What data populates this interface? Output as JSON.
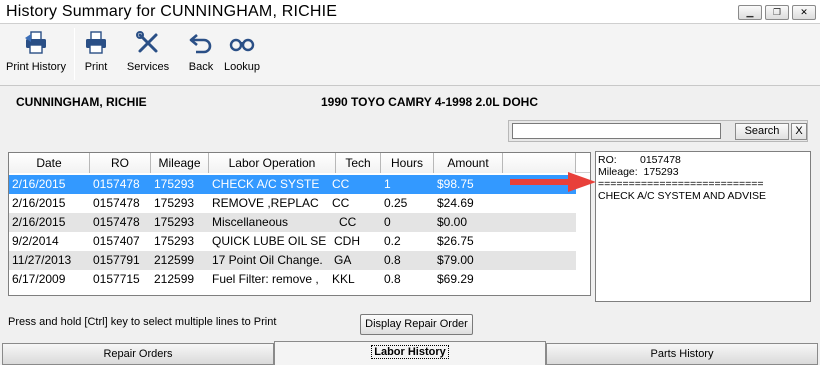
{
  "window": {
    "title": "History Summary for CUNNINGHAM, RICHIE",
    "minimize_glyph": "▁",
    "restore_glyph": "❐",
    "close_glyph": "✕"
  },
  "toolbar": {
    "print_history": "Print History",
    "print": "Print",
    "services": "Services",
    "back": "Back",
    "lookup": "Lookup"
  },
  "customer": {
    "name": "CUNNINGHAM, RICHIE",
    "vehicle": "1990 TOYO CAMRY  4-1998 2.0L DOHC"
  },
  "search": {
    "value": "",
    "button_label": "Search",
    "clear_label": "X"
  },
  "grid": {
    "columns": [
      "Date",
      "RO",
      "Mileage",
      "Labor Operation",
      "Tech",
      "Hours",
      "Amount"
    ],
    "rows": [
      {
        "date": "2/16/2015",
        "ro": "0157478",
        "mileage": "175293",
        "labor": "CHECK A/C SYSTE",
        "tech": "CC",
        "hours": "1",
        "amount": "$98.75"
      },
      {
        "date": "2/16/2015",
        "ro": "0157478",
        "mileage": "175293",
        "labor": "REMOVE ,REPLAC",
        "tech": "CC",
        "hours": "0.25",
        "amount": "$24.69"
      },
      {
        "date": "2/16/2015",
        "ro": "0157478",
        "mileage": "175293",
        "labor": "Miscellaneous",
        "tech": "CC",
        "hours": "0",
        "amount": "$0.00"
      },
      {
        "date": "9/2/2014",
        "ro": "0157407",
        "mileage": "175293",
        "labor": "QUICK LUBE OIL SE",
        "tech": "CDH",
        "hours": "0.2",
        "amount": "$26.75"
      },
      {
        "date": "11/27/2013",
        "ro": "0157791",
        "mileage": "212599",
        "labor": "17 Point Oil Change.",
        "tech": "GA",
        "hours": "0.8",
        "amount": "$79.00"
      },
      {
        "date": "6/17/2009",
        "ro": "0157715",
        "mileage": "212599",
        "labor": "Fuel Filter: remove ,",
        "tech": "KKL",
        "hours": "0.8",
        "amount": "$69.29"
      }
    ]
  },
  "detail": {
    "ro_line": "RO:        0157478",
    "mileage_line": "Mileage:  175293",
    "separator": "===========================",
    "description": "CHECK A/C SYSTEM AND ADVISE"
  },
  "footer": {
    "hint": "Press and hold [Ctrl] key to select multiple lines to Print",
    "display_repair_order": "Display Repair Order"
  },
  "tabs": {
    "repair_orders": "Repair Orders",
    "labor_history": "Labor History",
    "parts_history": "Parts History"
  },
  "colors": {
    "selection": "#3399ff",
    "alt_row": "#e4e4e4",
    "arrow": "#e8403a"
  }
}
